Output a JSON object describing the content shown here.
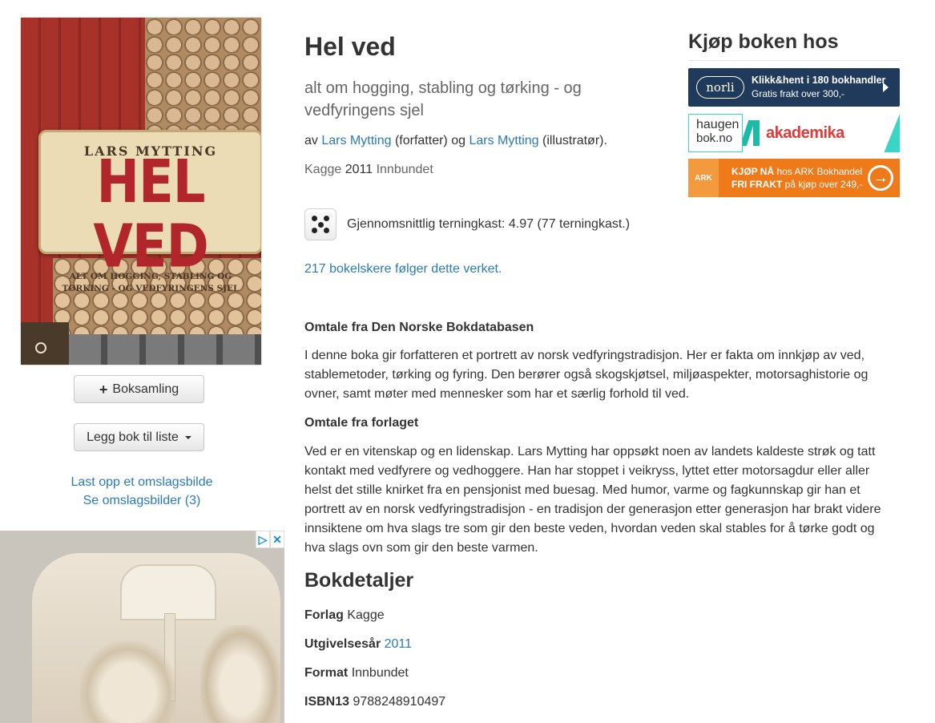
{
  "book": {
    "title": "Hel ved",
    "subtitle": "alt om hogging, stabling og tørking - og vedfyringens sjel",
    "by_prefix": "av",
    "author1": "Lars Mytting",
    "author1_role": "(forfatter) og",
    "author2": "Lars Mytting",
    "author2_role": "(illustratør).",
    "publisher": "Kagge",
    "year": "2011",
    "binding": "Innbundet"
  },
  "cover": {
    "author": "LARS MYTTING",
    "title": "HEL VED",
    "subtitle": "ALT OM HOGGING, STABLING OG TØRKING - OG VEDFYRINGENS SJEL"
  },
  "actions": {
    "boksamling_label": "Boksamling",
    "liste_label": "Legg bok til liste",
    "upload_cover": "Last opp et omslagsbilde",
    "see_covers": "Se omslagsbilder (3)"
  },
  "rating": {
    "text": "Gjennomsnittlig terningkast: 4.97 (77 terningkast.)",
    "dice_value": 5
  },
  "followers": "217 bokelskere følger dette verket.",
  "descriptions": [
    {
      "heading": "Omtale fra Den Norske Bokdatabasen",
      "text": "I denne boka gir forfatteren et portrett av norsk vedfyringstradisjon. Her er fakta om innkjøp av ved, stablemetoder, tørking og fyring. Den berører også skogskjøtsel, miljøaspekter, motorsaghistorie og ovner, samt møter med mennesker som har et særlig forhold til ved."
    },
    {
      "heading": "Omtale fra forlaget",
      "text": "Ved er en vitenskap og en lidenskap. Lars Mytting har oppsøkt noen av landets kaldeste strøk og tatt kontakt med vedfyrere og vedhoggere. Han har stoppet i veikryss, lyttet etter motorsagdur eller aller helst det stille knirket fra en pensjonist med buesag. Med humor, varme og fagkunnskap gir han et portrett av en norsk vedfyringstradisjon - en tradisjon der generasjon etter generasjon har brakt videre innsiktene om hva slags tre som gir den beste veden, hvordan veden skal stables for å tørke godt og hva slags ovn som gir den beste varmen."
    }
  ],
  "details": {
    "heading": "Bokdetaljer",
    "rows": [
      {
        "label": "Forlag",
        "value": "Kagge"
      },
      {
        "label": "Utgivelsesår",
        "value": "2011"
      },
      {
        "label": "Format",
        "value": "Innbundet"
      },
      {
        "label": "ISBN13",
        "value": "9788248910497"
      }
    ]
  },
  "buy": {
    "heading": "Kjøp boken hos",
    "norli": {
      "logo": "norli",
      "line1": "Klikk&hent i 180 bokhandler",
      "line2": "Gratis frakt over 300,-"
    },
    "haugen": {
      "logo1": "haugen",
      "logo2": "bok.no",
      "partner": "akademika"
    },
    "ark": {
      "logo": "ARK",
      "line1_bold": "KJØP NÅ",
      "line1_rest": "hos ARK Bokhandel",
      "line2_bold": "FRI FRAKT",
      "line2_rest": "på kjøp over 249,-"
    }
  },
  "colors": {
    "link": "#2a7ab8",
    "norli_bg": "#1f3a5a",
    "haugen_accent": "#3ad6c5",
    "akademika_red": "#e23a3a",
    "ark_orange": "#ef7a1a"
  }
}
